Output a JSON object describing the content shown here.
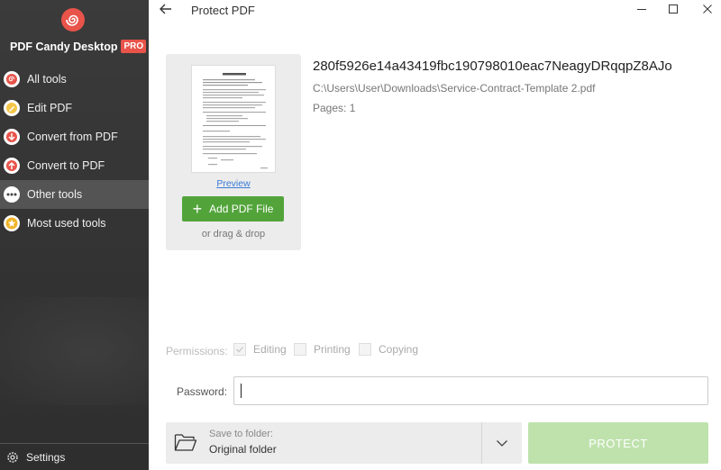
{
  "app": {
    "name": "PDF Candy Desktop",
    "badge": "PRO"
  },
  "sidebar": {
    "items": [
      {
        "label": "All tools",
        "icon": "spiral-icon",
        "color": "#e8534a"
      },
      {
        "label": "Edit PDF",
        "icon": "pencil-icon",
        "color": "#e8b83a"
      },
      {
        "label": "Convert from PDF",
        "icon": "arrow-down-icon",
        "color": "#e8534a"
      },
      {
        "label": "Convert to PDF",
        "icon": "arrow-up-icon",
        "color": "#e8534a"
      },
      {
        "label": "Other tools",
        "icon": "dots-icon",
        "color": "#555555",
        "active": true
      },
      {
        "label": "Most used tools",
        "icon": "star-icon",
        "color": "#f0b429"
      }
    ],
    "settings_label": "Settings"
  },
  "header": {
    "title": "Protect PDF"
  },
  "file": {
    "name": "280f5926e14a43419fbc190798010eac7NeagyDRqqpZ8AJo",
    "path": "C:\\Users\\User\\Downloads\\Service-Contract-Template 2.pdf",
    "pages": "Pages: 1",
    "preview_label": "Preview",
    "add_button_label": "Add PDF File",
    "drag_hint": "or drag & drop"
  },
  "permissions": {
    "label": "Permissions:",
    "options": [
      {
        "label": "Editing",
        "checked": true
      },
      {
        "label": "Printing",
        "checked": false
      },
      {
        "label": "Copying",
        "checked": false
      }
    ]
  },
  "password": {
    "label": "Password:",
    "value": ""
  },
  "save": {
    "label": "Save to folder:",
    "value": "Original folder"
  },
  "protect_button_label": "PROTECT",
  "colors": {
    "accent_green": "#52a43a",
    "disabled_green": "#bfe2ad",
    "brand_red": "#e8534a"
  }
}
